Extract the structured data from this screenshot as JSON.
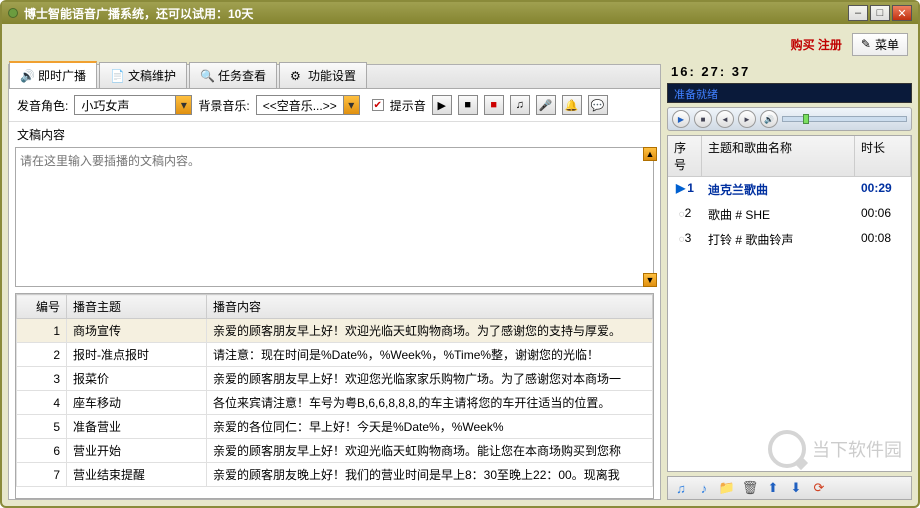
{
  "window": {
    "title": "博士智能语音广播系统，还可以试用：10天"
  },
  "topbar": {
    "link": "购买 注册",
    "menu": "菜单"
  },
  "tabs": [
    {
      "label": "即时广播",
      "icon": "speaker-icon",
      "active": true
    },
    {
      "label": "文稿维护",
      "icon": "document-icon",
      "active": false
    },
    {
      "label": "任务查看",
      "icon": "search-icon",
      "active": false
    },
    {
      "label": "功能设置",
      "icon": "gear-icon",
      "active": false
    }
  ],
  "toolbar": {
    "voice_label": "发音角色:",
    "voice_value": "小巧女声",
    "bgm_label": "背景音乐:",
    "bgm_value": "<<空音乐...>>",
    "hint_sound": "提示音",
    "hint_checked": true
  },
  "editor": {
    "label": "文稿内容",
    "placeholder": "请在这里输入要插播的文稿内容。"
  },
  "grid": {
    "columns": [
      "编号",
      "播音主题",
      "播音内容"
    ],
    "rows": [
      {
        "num": "1",
        "topic": "商场宣传",
        "content": "亲爱的顾客朋友早上好！欢迎光临天虹购物商场。为了感谢您的支持与厚爱。",
        "selected": true
      },
      {
        "num": "2",
        "topic": "报时-准点报时",
        "content": "请注意：现在时间是%Date%，%Week%，%Time%整，谢谢您的光临！"
      },
      {
        "num": "3",
        "topic": "报菜价",
        "content": "亲爱的顾客朋友早上好！欢迎您光临家家乐购物广场。为了感谢您对本商场一"
      },
      {
        "num": "4",
        "topic": "座车移动",
        "content": "各位来宾请注意！车号为粤B,6,6,8,8,8,的车主请将您的车开往适当的位置。"
      },
      {
        "num": "5",
        "topic": "准备营业",
        "content": "亲爱的各位同仁：早上好！今天是%Date%，%Week%"
      },
      {
        "num": "6",
        "topic": "营业开始",
        "content": "亲爱的顾客朋友早上好！欢迎光临天虹购物商场。能让您在本商场购买到您称"
      },
      {
        "num": "7",
        "topic": "营业结束提醒",
        "content": "亲爱的顾客朋友晚上好！我们的营业时间是早上8：30至晚上22：00。现离我"
      }
    ]
  },
  "clock": "16: 27: 37",
  "marquee": "准备就绪",
  "playlist": {
    "columns": {
      "num": "序号",
      "name": "主题和歌曲名称",
      "dur": "时长"
    },
    "items": [
      {
        "num": "1",
        "name": "迪克兰歌曲",
        "dur": "00:29",
        "active": true
      },
      {
        "num": "2",
        "name": "歌曲 # SHE",
        "dur": "00:06",
        "active": false
      },
      {
        "num": "3",
        "name": "打铃 # 歌曲铃声",
        "dur": "00:08",
        "active": false
      }
    ]
  },
  "watermark": "当下软件园"
}
